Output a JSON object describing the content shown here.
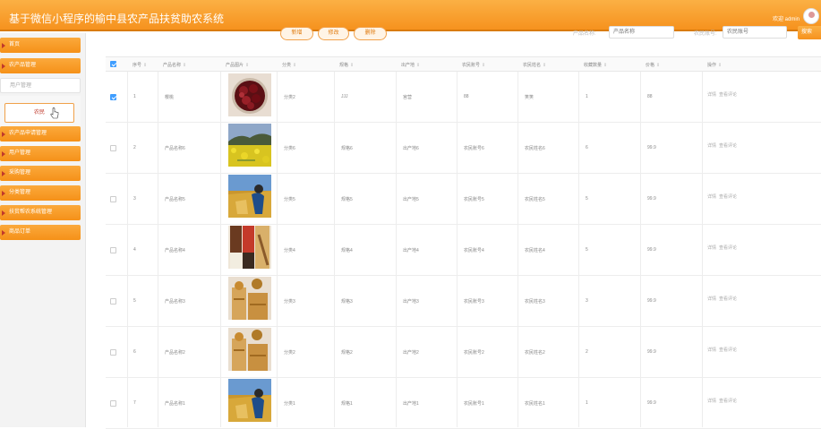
{
  "header": {
    "title": "基于微信小程序的榆中县农产品扶贫助农系统",
    "welcome": "欢迎 admin"
  },
  "sidebar": {
    "items": [
      {
        "label": "首页"
      },
      {
        "label": "农产品管理"
      },
      {
        "label": "用户管理"
      },
      {
        "label": "农产品申请管理"
      },
      {
        "label": "用户管理"
      },
      {
        "label": "采购管理"
      },
      {
        "label": "分类管理"
      },
      {
        "label": "扶贫帮农系统管理"
      },
      {
        "label": "商品订单"
      }
    ],
    "submenu_label": "农民"
  },
  "toolbar": {
    "add": "新增",
    "edit": "修改",
    "delete": "删除",
    "name_label": "产品名称:",
    "name_placeholder": "产品名称",
    "farmer_label": "农民账号:",
    "farmer_placeholder": "农民账号",
    "search": "搜索"
  },
  "table": {
    "headers": [
      "序号",
      "产品名称",
      "产品图片",
      "分类",
      "规格",
      "出产地",
      "农民账号",
      "农民姓名",
      "收藏数量",
      "价格",
      "操作"
    ],
    "rows": [
      {
        "index": "1",
        "name": "樱桃",
        "category": "分类2",
        "spec": "JJJ",
        "origin": "宫营",
        "account": "88",
        "farmer": "笑笑",
        "fav": "1",
        "price": "88",
        "checked": true
      },
      {
        "index": "2",
        "name": "产品名称6",
        "category": "分类6",
        "spec": "规格6",
        "origin": "出产地6",
        "account": "农民账号6",
        "farmer": "农民姓名6",
        "fav": "6",
        "price": "99.9",
        "checked": false
      },
      {
        "index": "3",
        "name": "产品名称5",
        "category": "分类5",
        "spec": "规格5",
        "origin": "出产地5",
        "account": "农民账号5",
        "farmer": "农民姓名5",
        "fav": "5",
        "price": "99.9",
        "checked": false
      },
      {
        "index": "4",
        "name": "产品名称4",
        "category": "分类4",
        "spec": "规格4",
        "origin": "出产地4",
        "account": "农民账号4",
        "farmer": "农民姓名4",
        "fav": "5",
        "price": "99.9",
        "checked": false
      },
      {
        "index": "5",
        "name": "产品名称3",
        "category": "分类3",
        "spec": "规格3",
        "origin": "出产地3",
        "account": "农民账号3",
        "farmer": "农民姓名3",
        "fav": "3",
        "price": "99.9",
        "checked": false
      },
      {
        "index": "6",
        "name": "产品名称2",
        "category": "分类2",
        "spec": "规格2",
        "origin": "出产地2",
        "account": "农民账号2",
        "farmer": "农民姓名2",
        "fav": "2",
        "price": "99.9",
        "checked": false
      },
      {
        "index": "7",
        "name": "产品名称1",
        "category": "分类1",
        "spec": "规格1",
        "origin": "出产地1",
        "account": "农民账号1",
        "farmer": "农民姓名1",
        "fav": "1",
        "price": "99.9",
        "checked": false
      }
    ],
    "ops": {
      "detail": "详情",
      "review": "查看评论"
    }
  },
  "colors": {
    "accent": "#f6921e",
    "accent_dark": "#d97b0c",
    "menu_arrow": "#c0392b",
    "checkbox": "#409eff"
  }
}
